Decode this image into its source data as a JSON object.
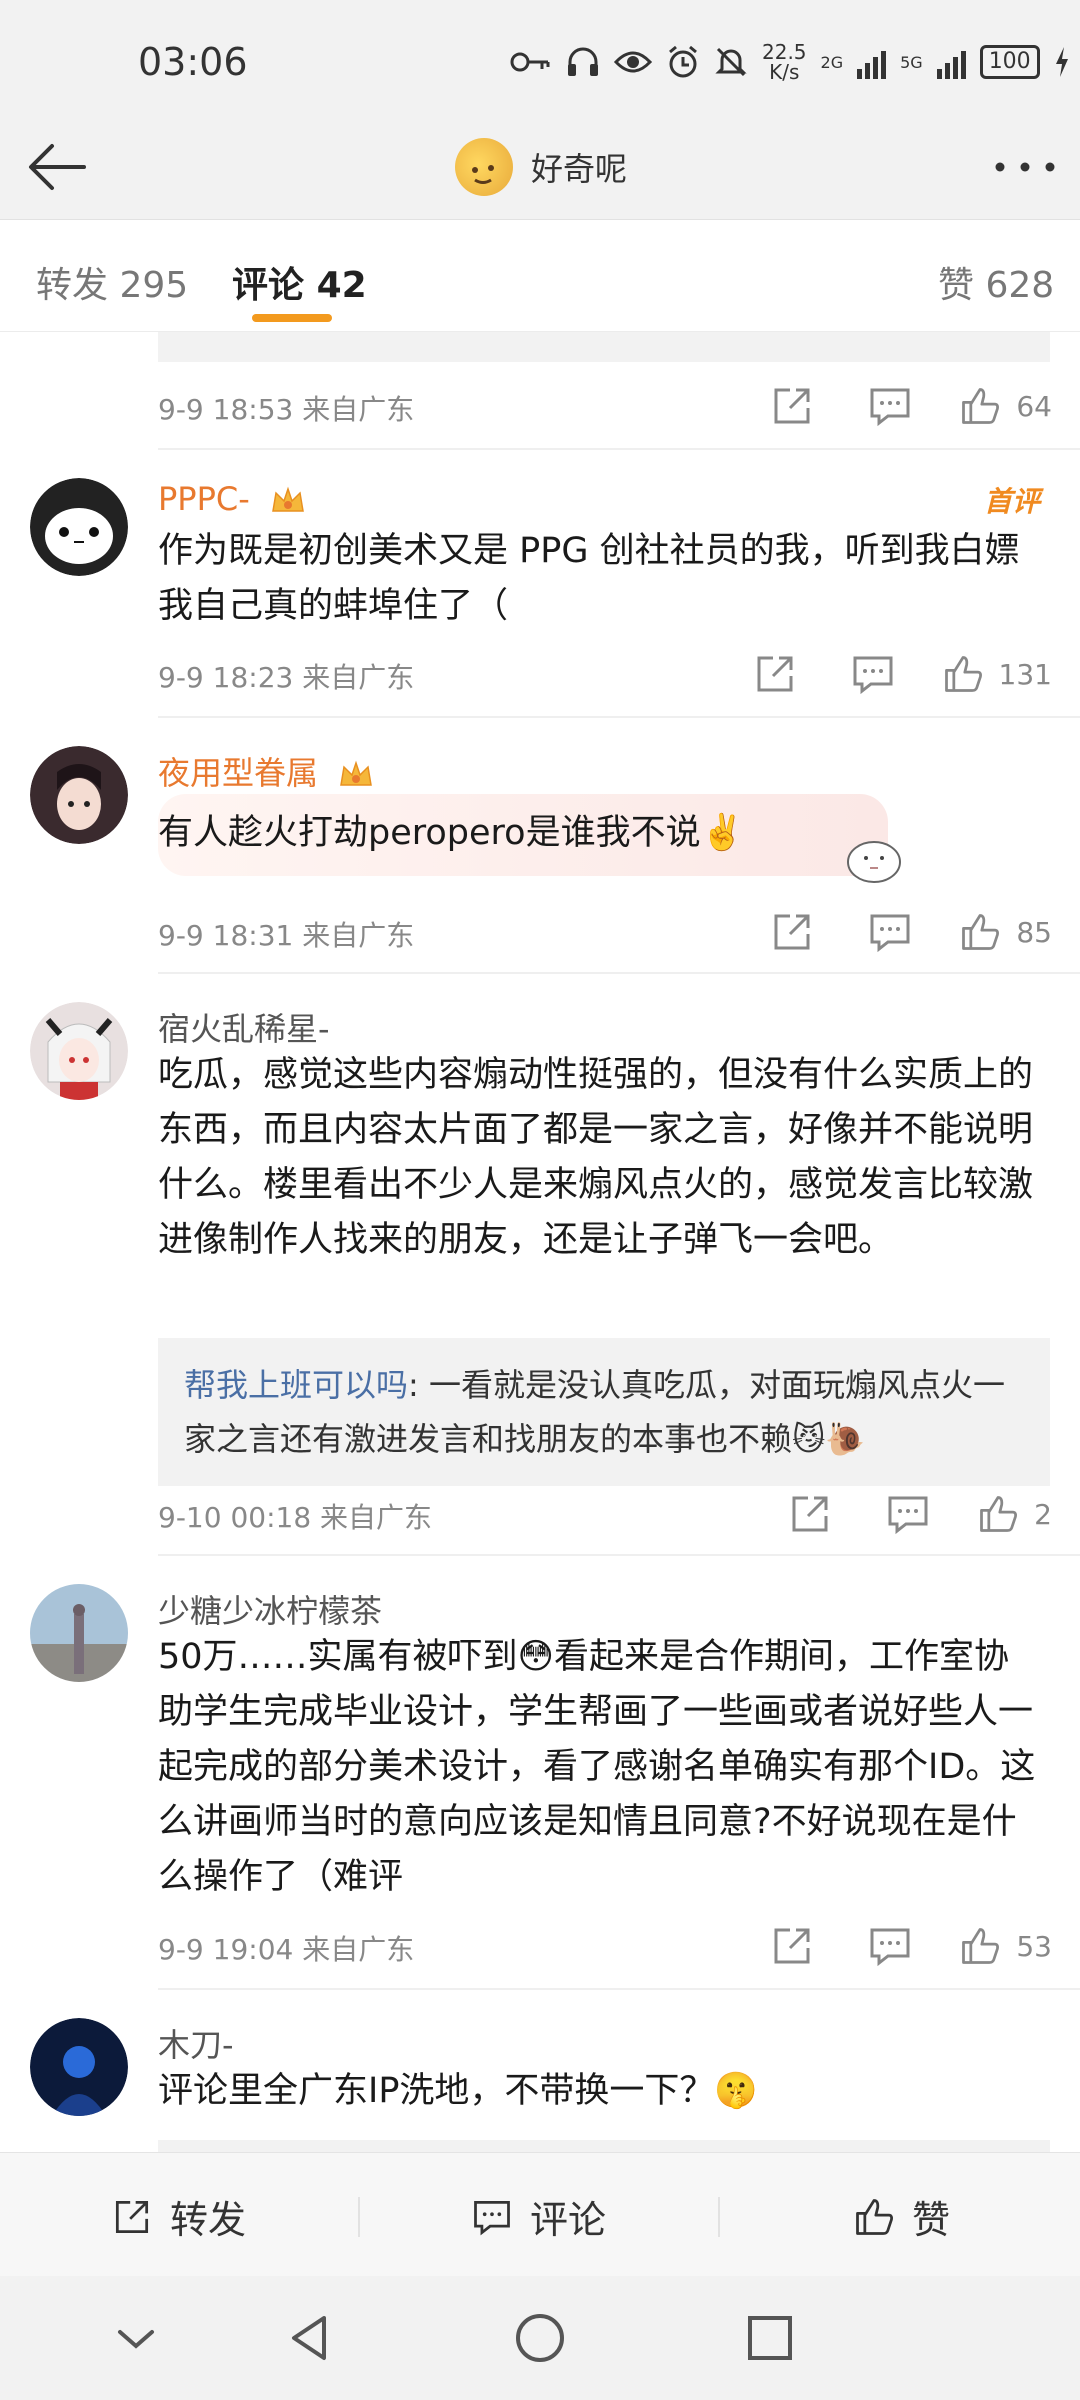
{
  "status": {
    "time": "03:06",
    "speed_value": "22.5",
    "speed_unit": "K/s",
    "net1": "2G",
    "net2": "5G",
    "battery": "100"
  },
  "header": {
    "title": "好奇呢"
  },
  "tabs": [
    {
      "label": "转发",
      "count": "295"
    },
    {
      "label": "评论",
      "count": "42"
    },
    {
      "label": "赞",
      "count": "628"
    }
  ],
  "comments": [
    {
      "meta": "9-9 18:53 来自广东",
      "likes": "64"
    },
    {
      "name": "PPPC-",
      "tag": "首评",
      "text": "作为既是初创美术又是 PPG 创社社员的我，听到我白嫖我自己真的蚌埠住了（",
      "meta": "9-9 18:23 来自广东",
      "likes": "131"
    },
    {
      "name": "夜用型眷属",
      "text": "有人趁火打劫peropero是谁我不说✌️",
      "meta": "9-9 18:31 来自广东",
      "likes": "85"
    },
    {
      "name": "宿火乱稀星-",
      "text": "吃瓜，感觉这些内容煽动性挺强的，但没有什么实质上的东西，而且内容太片面了都是一家之言，好像并不能说明什么。楼里看出不少人是来煽风点火的，感觉发言比较激进像制作人找来的朋友，还是让子弹飞一会吧。",
      "reply_name": "帮我上班可以吗",
      "reply_text": ": 一看就是没认真吃瓜，对面玩煽风点火一家之言还有激进发言和找朋友的本事也不赖😼🐌",
      "meta": "9-10 00:18 来自广东",
      "likes": "2"
    },
    {
      "name": "少糖少冰柠檬茶",
      "text": "50万……实属有被吓到😳看起来是合作期间，工作室协助学生完成毕业设计，学生帮画了一些画或者说好些人一起完成的部分美术设计，看了感谢名单确实有那个ID。这么讲画师当时的意向应该是知情且同意?不好说现在是什么操作了（难评",
      "meta": "9-9 19:04 来自广东",
      "likes": "53"
    },
    {
      "name": "木刀-",
      "text": "评论里全广东IP洗地，不带换一下？🤫"
    }
  ],
  "bottom": {
    "repost": "转发",
    "comment": "评论",
    "like": "赞"
  }
}
